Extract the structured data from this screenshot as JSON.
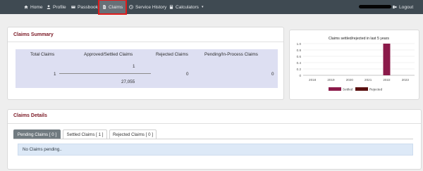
{
  "nav": {
    "home": "Home",
    "profile": "Profile",
    "passbook": "Passbook",
    "claims": "Claims",
    "service_history": "Service History",
    "calculators": "Calculators",
    "logout": "Logout"
  },
  "summary": {
    "title": "Claims Summary",
    "headers": [
      "Total Claims",
      "Approved/Settled Claims",
      "Rejected Claims",
      "Pending/In-Process Claims"
    ],
    "total_claims": "1",
    "approved_count": "1",
    "approved_amount": "27,055",
    "rejected": "0",
    "pending": "0"
  },
  "chart_data": {
    "type": "bar",
    "title": "Claims settled/rejected in last 5 years",
    "categories": [
      "2018",
      "2019",
      "2020",
      "2021",
      "2022",
      "2023"
    ],
    "series": [
      {
        "name": "Settled",
        "values": [
          0,
          0,
          0,
          0,
          1,
          0
        ],
        "color": "#8b1a4a"
      },
      {
        "name": "Rejected",
        "values": [
          0,
          0,
          0,
          0,
          0,
          0
        ],
        "color": "#5a1010"
      }
    ],
    "yticks": [
      "1.0",
      "0.8",
      "0.6",
      "0.4",
      "0.2",
      "0"
    ],
    "ylim": [
      0,
      1
    ],
    "legend_position": "bottom",
    "grid": true
  },
  "details": {
    "title": "Claims Details",
    "tabs": [
      "Pending Claims [ 0 ]",
      "Settled Claims [ 1 ]",
      "Rejected Claims [ 0 ]"
    ],
    "message": "No Claims pending.."
  }
}
